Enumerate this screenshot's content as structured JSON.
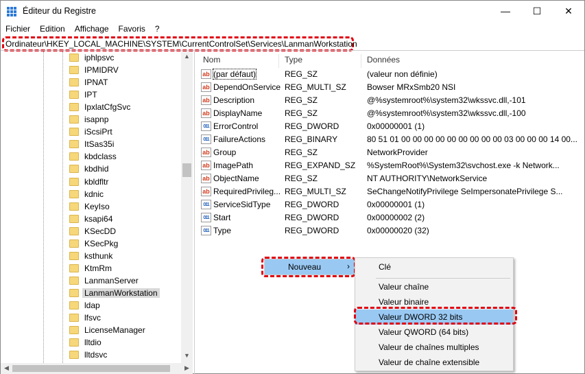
{
  "window": {
    "title": "Éditeur du Registre",
    "minimize": "—",
    "maximize": "☐",
    "close": "✕"
  },
  "menu": [
    "Fichier",
    "Edition",
    "Affichage",
    "Favoris",
    "?"
  ],
  "address": "Ordinateur\\HKEY_LOCAL_MACHINE\\SYSTEM\\CurrentControlSet\\Services\\LanmanWorkstation",
  "tree": [
    "iphlpsvc",
    "IPMIDRV",
    "IPNAT",
    "IPT",
    "IpxlatCfgSvc",
    "isapnp",
    "iScsiPrt",
    "ItSas35i",
    "kbdclass",
    "kbdhid",
    "kbldfltr",
    "kdnic",
    "KeyIso",
    "ksapi64",
    "KSecDD",
    "KSecPkg",
    "ksthunk",
    "KtmRm",
    "LanmanServer",
    "LanmanWorkstation",
    "ldap",
    "lfsvc",
    "LicenseManager",
    "lltdio",
    "lltdsvc"
  ],
  "tree_selected": "LanmanWorkstation",
  "columns": {
    "name": "Nom",
    "type": "Type",
    "data": "Données"
  },
  "values": [
    {
      "icon": "sz",
      "name": "(par défaut)",
      "type": "REG_SZ",
      "data": "(valeur non définie)"
    },
    {
      "icon": "sz",
      "name": "DependOnService",
      "type": "REG_MULTI_SZ",
      "data": "Bowser MRxSmb20 NSI"
    },
    {
      "icon": "sz",
      "name": "Description",
      "type": "REG_SZ",
      "data": "@%systemroot%\\system32\\wkssvc.dll,-101"
    },
    {
      "icon": "sz",
      "name": "DisplayName",
      "type": "REG_SZ",
      "data": "@%systemroot%\\system32\\wkssvc.dll,-100"
    },
    {
      "icon": "dw",
      "name": "ErrorControl",
      "type": "REG_DWORD",
      "data": "0x00000001 (1)"
    },
    {
      "icon": "dw",
      "name": "FailureActions",
      "type": "REG_BINARY",
      "data": "80 51 01 00 00 00 00 00 00 00 00 00 03 00 00 00 14 00..."
    },
    {
      "icon": "sz",
      "name": "Group",
      "type": "REG_SZ",
      "data": "NetworkProvider"
    },
    {
      "icon": "sz",
      "name": "ImagePath",
      "type": "REG_EXPAND_SZ",
      "data": "%SystemRoot%\\System32\\svchost.exe -k Network..."
    },
    {
      "icon": "sz",
      "name": "ObjectName",
      "type": "REG_SZ",
      "data": "NT AUTHORITY\\NetworkService"
    },
    {
      "icon": "sz",
      "name": "RequiredPrivileg...",
      "type": "REG_MULTI_SZ",
      "data": "SeChangeNotifyPrivilege SeImpersonatePrivilege S..."
    },
    {
      "icon": "dw",
      "name": "ServiceSidType",
      "type": "REG_DWORD",
      "data": "0x00000001 (1)"
    },
    {
      "icon": "dw",
      "name": "Start",
      "type": "REG_DWORD",
      "data": "0x00000002 (2)"
    },
    {
      "icon": "dw",
      "name": "Type",
      "type": "REG_DWORD",
      "data": "0x00000020 (32)"
    }
  ],
  "context_menu": {
    "new_label": "Nouveau",
    "arrow": "›"
  },
  "submenu": [
    "Clé",
    "Valeur chaîne",
    "Valeur binaire",
    "Valeur DWORD 32 bits",
    "Valeur QWORD (64 bits)",
    "Valeur de chaînes multiples",
    "Valeur de chaîne extensible"
  ],
  "submenu_highlighted": "Valeur DWORD 32 bits",
  "icon_text": {
    "sz": "ab",
    "dw": "011"
  },
  "scroll": {
    "up": "▲",
    "down": "▼",
    "left": "◀",
    "right": "▶"
  }
}
